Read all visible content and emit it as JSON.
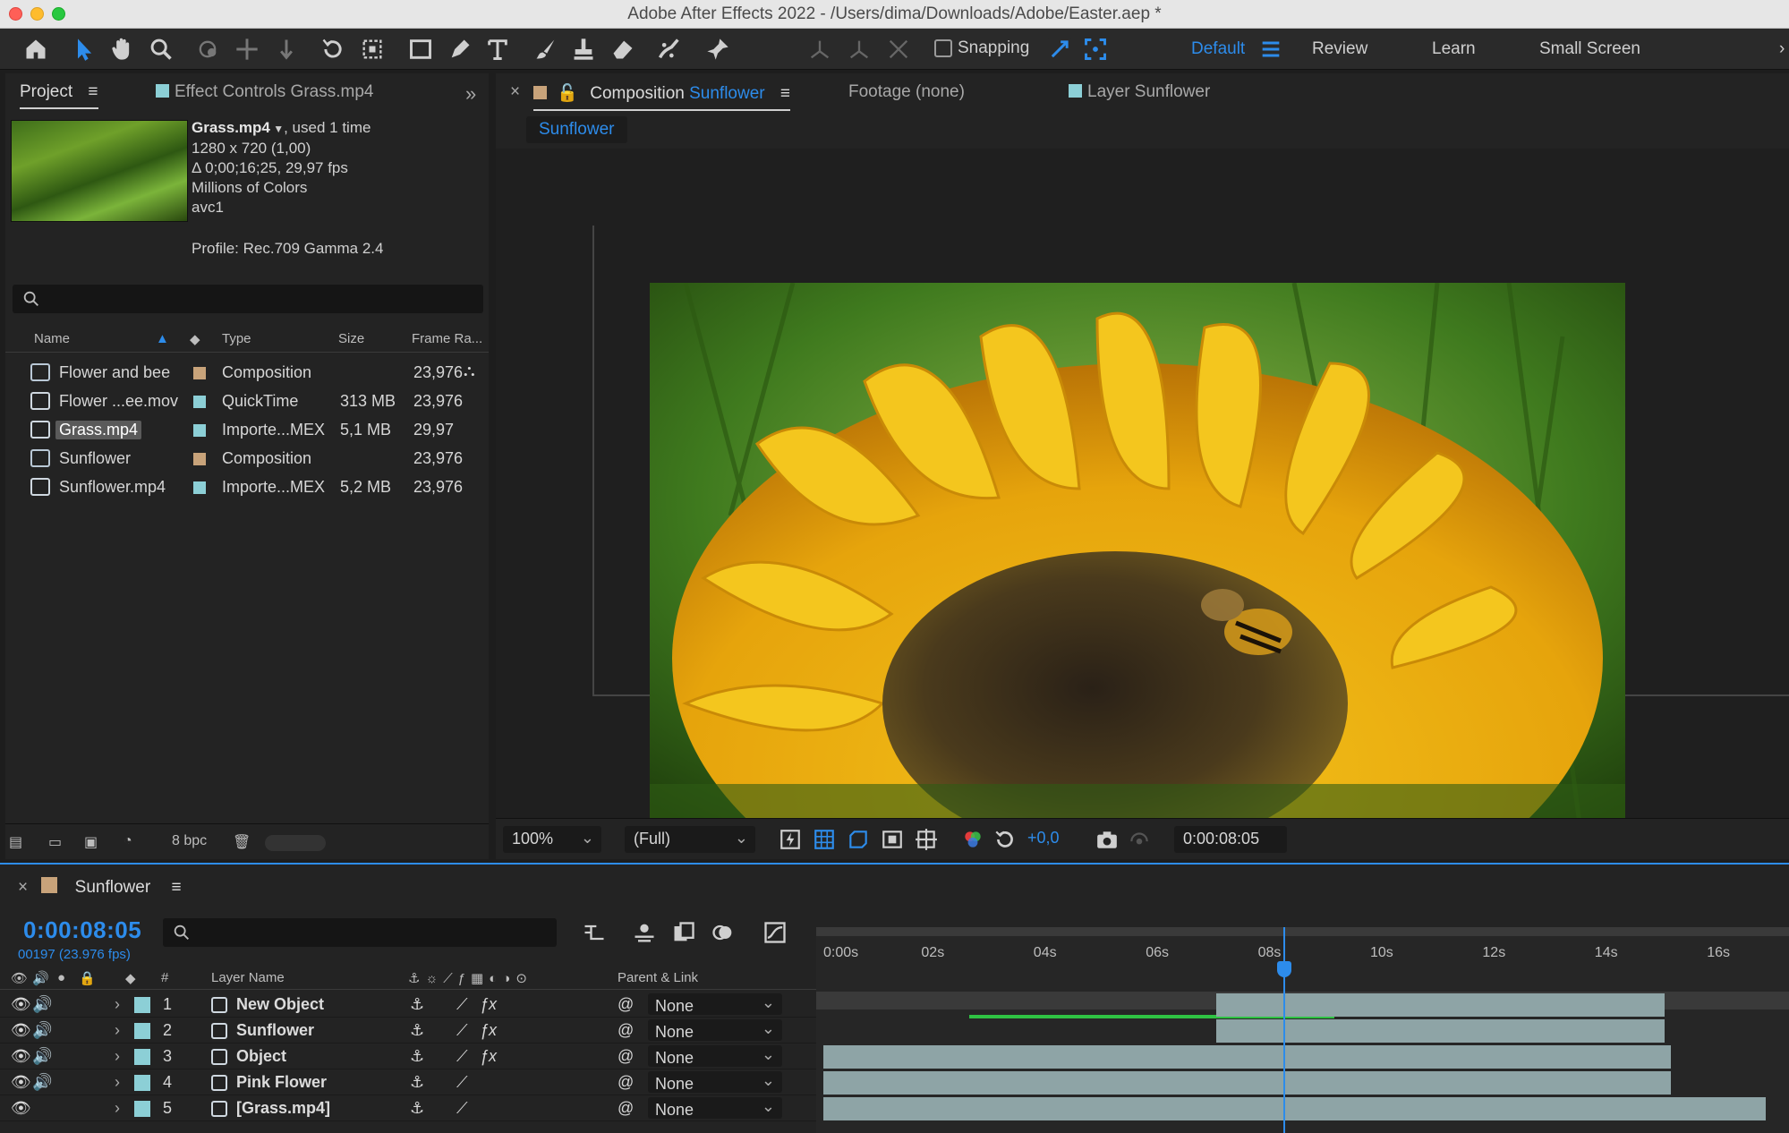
{
  "window": {
    "title": "Adobe After Effects 2022 - /Users/dima/Downloads/Adobe/Easter.aep *"
  },
  "toolbar": {
    "tools": [
      "home-icon",
      "selection-icon",
      "hand-icon",
      "zoom-icon",
      "orbit-icon",
      "pan-icon",
      "dolly-icon",
      "rotate-icon",
      "region-icon",
      "rectangle-icon",
      "pen-icon",
      "type-icon",
      "brush-icon",
      "clone-stamp-icon",
      "eraser-icon",
      "roto-brush-icon",
      "puppet-pin-icon"
    ],
    "snapping_label": "Snapping",
    "workspaces": [
      "Default",
      "Review",
      "Learn",
      "Small Screen"
    ],
    "active_workspace": "Default"
  },
  "project": {
    "tab_label": "Project",
    "effect_tab_label": "Effect Controls Grass.mp4",
    "meta": {
      "name": "Grass.mp4",
      "used": ", used 1 time",
      "resolution": "1280 x 720 (1,00)",
      "duration": "Δ 0;00;16;25, 29,97 fps",
      "colors": "Millions of Colors",
      "codec": "avc1",
      "profile": "Profile: Rec.709 Gamma 2.4"
    },
    "columns": {
      "name": "Name",
      "type": "Type",
      "size": "Size",
      "frame_rate": "Frame Ra..."
    },
    "items": [
      {
        "name": "Flower and bee",
        "type": "Composition",
        "size": "",
        "fps": "23,976",
        "label_color": "#c8a37a",
        "kind": "comp"
      },
      {
        "name": "Flower ...ee.mov",
        "type": "QuickTime",
        "size": "313 MB",
        "fps": "23,976",
        "label_color": "#8ccfd6",
        "kind": "footage"
      },
      {
        "name": "Grass.mp4",
        "type": "Importe...MEX",
        "size": "5,1 MB",
        "fps": "29,97",
        "label_color": "#8ccfd6",
        "kind": "footage",
        "selected": true
      },
      {
        "name": "Sunflower",
        "type": "Composition",
        "size": "",
        "fps": "23,976",
        "label_color": "#c8a37a",
        "kind": "comp"
      },
      {
        "name": "Sunflower.mp4",
        "type": "Importe...MEX",
        "size": "5,2 MB",
        "fps": "23,976",
        "label_color": "#8ccfd6",
        "kind": "footage"
      }
    ],
    "bpc": "8 bpc"
  },
  "composition": {
    "tab_prefix": "Composition",
    "tab_name": "Sunflower",
    "footage_tab": "Footage (none)",
    "layer_tab": "Layer Sunflower",
    "subtab": "Sunflower",
    "zoom": "100%",
    "resolution": "(Full)",
    "exposure": "+0,0",
    "time": "0:00:08:05"
  },
  "timeline": {
    "tab_name": "Sunflower",
    "timecode": "0:00:08:05",
    "fps_label": "00197 (23.976 fps)",
    "columns": {
      "num": "#",
      "layer_name": "Layer Name",
      "parent": "Parent & Link"
    },
    "ticks": [
      "0:00s",
      "02s",
      "04s",
      "06s",
      "08s",
      "10s",
      "12s",
      "14s",
      "16s"
    ],
    "playhead_seconds": 8.2,
    "layers": [
      {
        "num": "1",
        "name": "New Object",
        "parent": "None",
        "fx": true,
        "audio": true,
        "in": 7.0,
        "out": 15.0
      },
      {
        "num": "2",
        "name": "Sunflower",
        "parent": "None",
        "fx": true,
        "audio": true,
        "in": 7.0,
        "out": 15.0
      },
      {
        "num": "3",
        "name": "Object",
        "parent": "None",
        "fx": true,
        "audio": true,
        "in": 0.0,
        "out": 15.1
      },
      {
        "num": "4",
        "name": "Pink Flower",
        "parent": "None",
        "fx": false,
        "audio": true,
        "in": 0.0,
        "out": 15.1
      },
      {
        "num": "5",
        "name": "[Grass.mp4]",
        "parent": "None",
        "fx": false,
        "audio": false,
        "in": 0.0,
        "out": 16.8
      }
    ],
    "colors": {
      "accent": "#2d8ceb",
      "layer_label": "#8ccfd6",
      "bar": "#8ea4a6"
    }
  }
}
